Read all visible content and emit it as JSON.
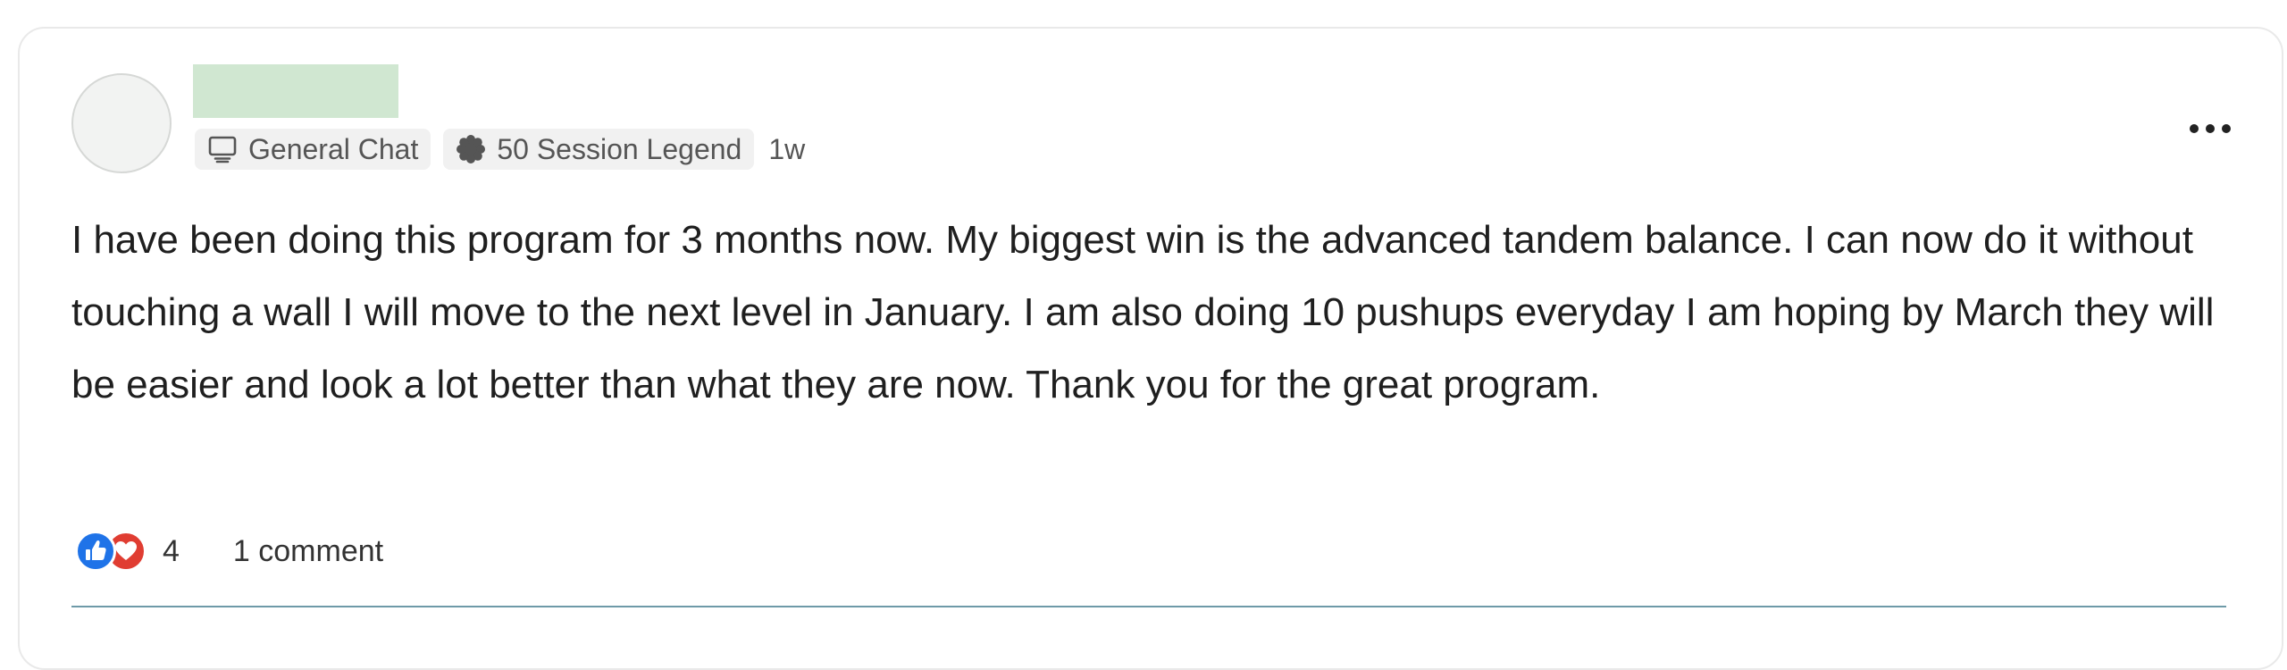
{
  "post": {
    "channel_label": "General Chat",
    "channel_icon": "chat-screen-icon",
    "badge_label": "50 Session Legend",
    "badge_icon": "badge-seal-icon",
    "time": "1w",
    "body": "I have been doing this program for 3 months now. My biggest win is the advanced tandem balance. I can now do it without touching a wall I will move to the next level in January. I am also doing 10 pushups everyday I am hoping by March they will be easier and look a lot better than what they are now. Thank you for the great program.",
    "reaction_count": "4",
    "comment_label": "1 comment",
    "reaction_icons": [
      "like-icon",
      "love-icon"
    ]
  },
  "colors": {
    "like": "#1f73e8",
    "love": "#e03d32",
    "divider": "#6e9aa8",
    "name_placeholder": "#d0e7d1"
  }
}
